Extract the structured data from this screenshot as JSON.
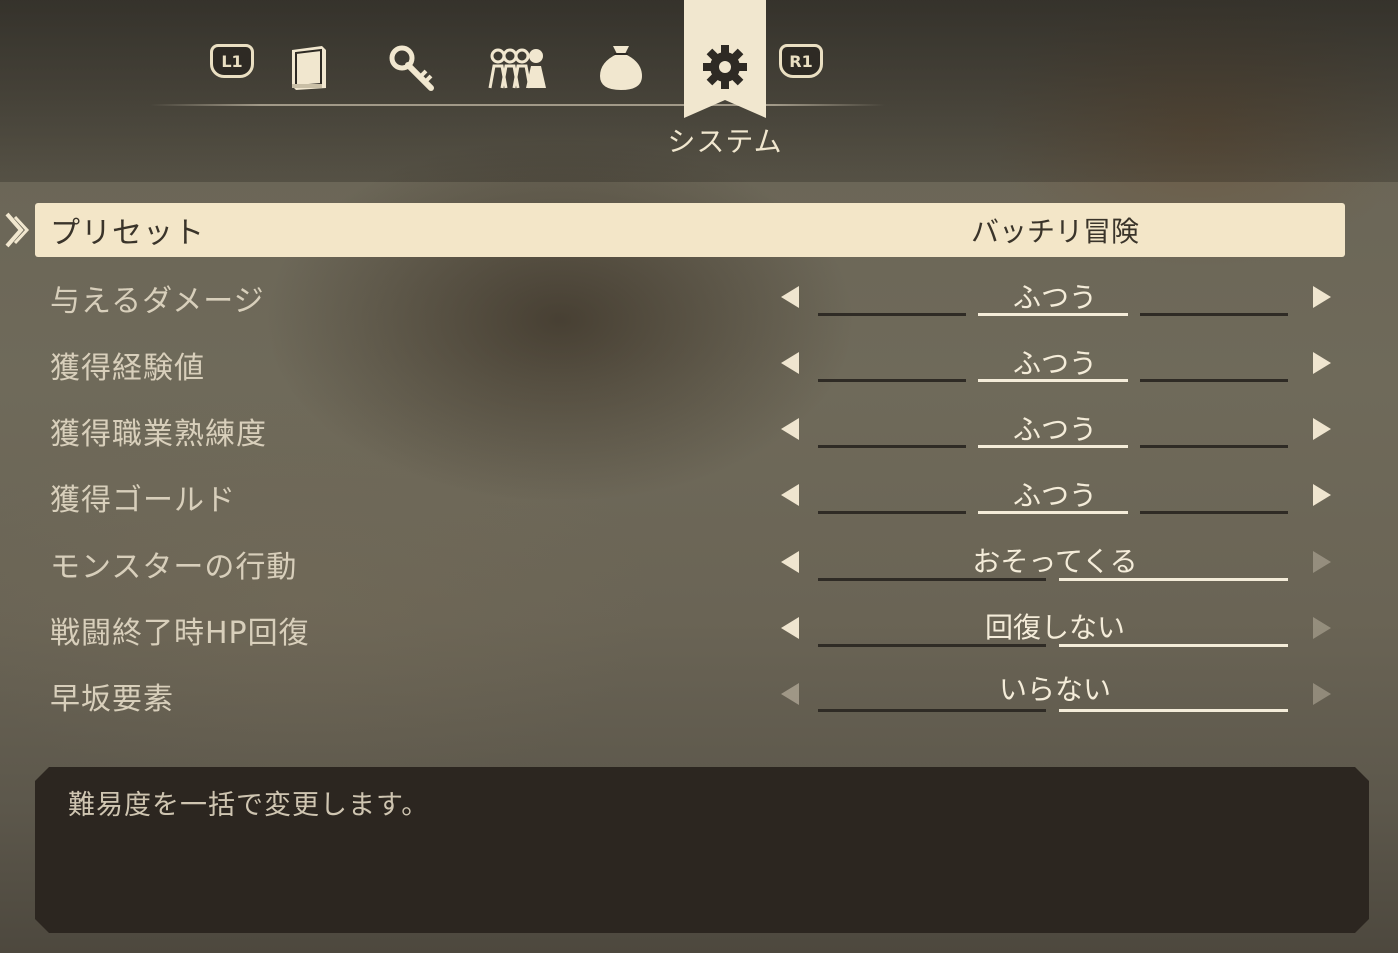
{
  "header": {
    "l1_label": "L1",
    "r1_label": "R1",
    "tabs": [
      {
        "icon": "book-icon"
      },
      {
        "icon": "key-icon"
      },
      {
        "icon": "party-icon"
      },
      {
        "icon": "bag-icon"
      },
      {
        "icon": "gear-icon",
        "active": true
      }
    ],
    "active_tab_label": "システム"
  },
  "preset": {
    "label": "プリセット",
    "value": "バッチリ冒険"
  },
  "settings": [
    {
      "label": "与えるダメージ",
      "value": "ふつう"
    },
    {
      "label": "獲得経験値",
      "value": "ふつう"
    },
    {
      "label": "獲得職業熟練度",
      "value": "ふつう"
    },
    {
      "label": "獲得ゴールド",
      "value": "ふつう"
    },
    {
      "label": "モンスターの行動",
      "value": "おそってくる"
    },
    {
      "label": "戦闘終了時HP回復",
      "value": "回復しない"
    },
    {
      "label": "早坂要素",
      "value": "いらない"
    }
  ],
  "description": "難易度を一括で変更します。",
  "colors": {
    "highlight": "#f3e6c8",
    "text_light": "#f4ecd9",
    "panel": "#2c2620"
  }
}
